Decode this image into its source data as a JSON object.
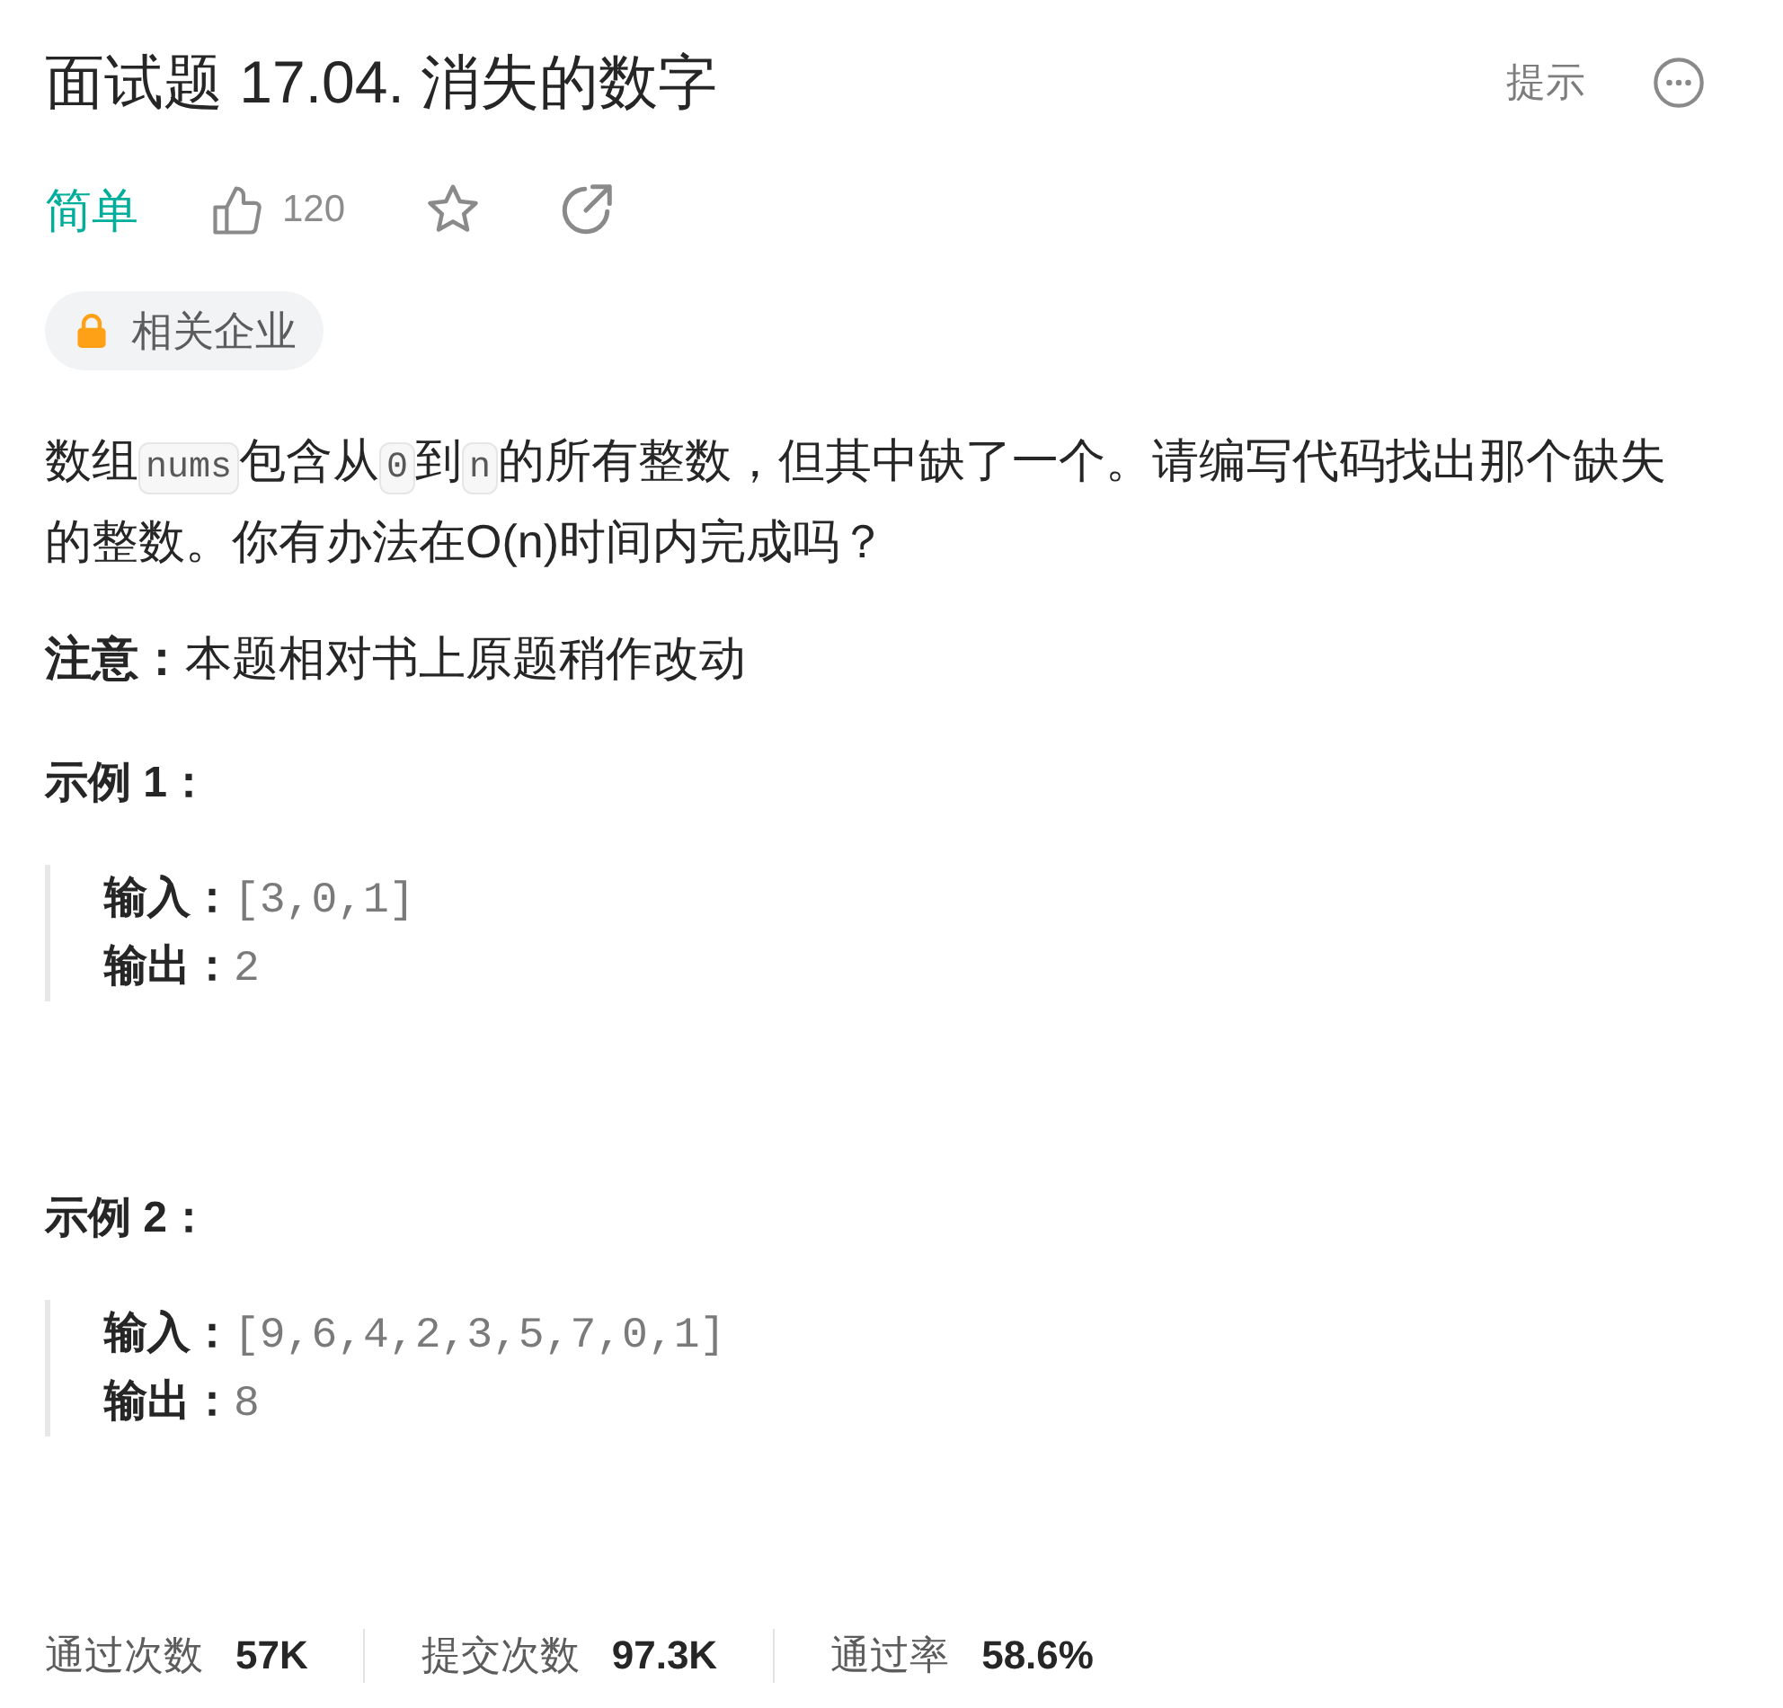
{
  "header": {
    "title": "面试题 17.04. 消失的数字",
    "hint_button": "提示"
  },
  "meta": {
    "difficulty": "简单",
    "likes": "120"
  },
  "company_tag": {
    "label": "相关企业"
  },
  "description": [
    {
      "kind": "text",
      "text": "数组"
    },
    {
      "kind": "code",
      "text": "nums"
    },
    {
      "kind": "text",
      "text": "包含从"
    },
    {
      "kind": "code",
      "text": "0"
    },
    {
      "kind": "text",
      "text": "到"
    },
    {
      "kind": "code",
      "text": "n"
    },
    {
      "kind": "text",
      "text": "的所有整数，但其中缺了一个。请编写代码找出那个缺失的整数。你有办法在O(n)时间内完成吗？"
    }
  ],
  "note": "**注意：**本题相对书上原题稍作改动",
  "examples": [
    {
      "title": "示例 1：",
      "lines": [
        {
          "label": "输入：",
          "value": "[3,0,1]"
        },
        {
          "label": "输出：",
          "value": "2"
        }
      ]
    },
    {
      "title": "示例 2：",
      "lines": [
        {
          "label": "输入：",
          "value": "[9,6,4,2,3,5,7,0,1]"
        },
        {
          "label": "输出：",
          "value": "8"
        }
      ]
    }
  ],
  "stats": [
    {
      "label": "通过次数",
      "value": "57K"
    },
    {
      "label": "提交次数",
      "value": "97.3K"
    },
    {
      "label": "通过率",
      "value": "58.6%"
    }
  ]
}
